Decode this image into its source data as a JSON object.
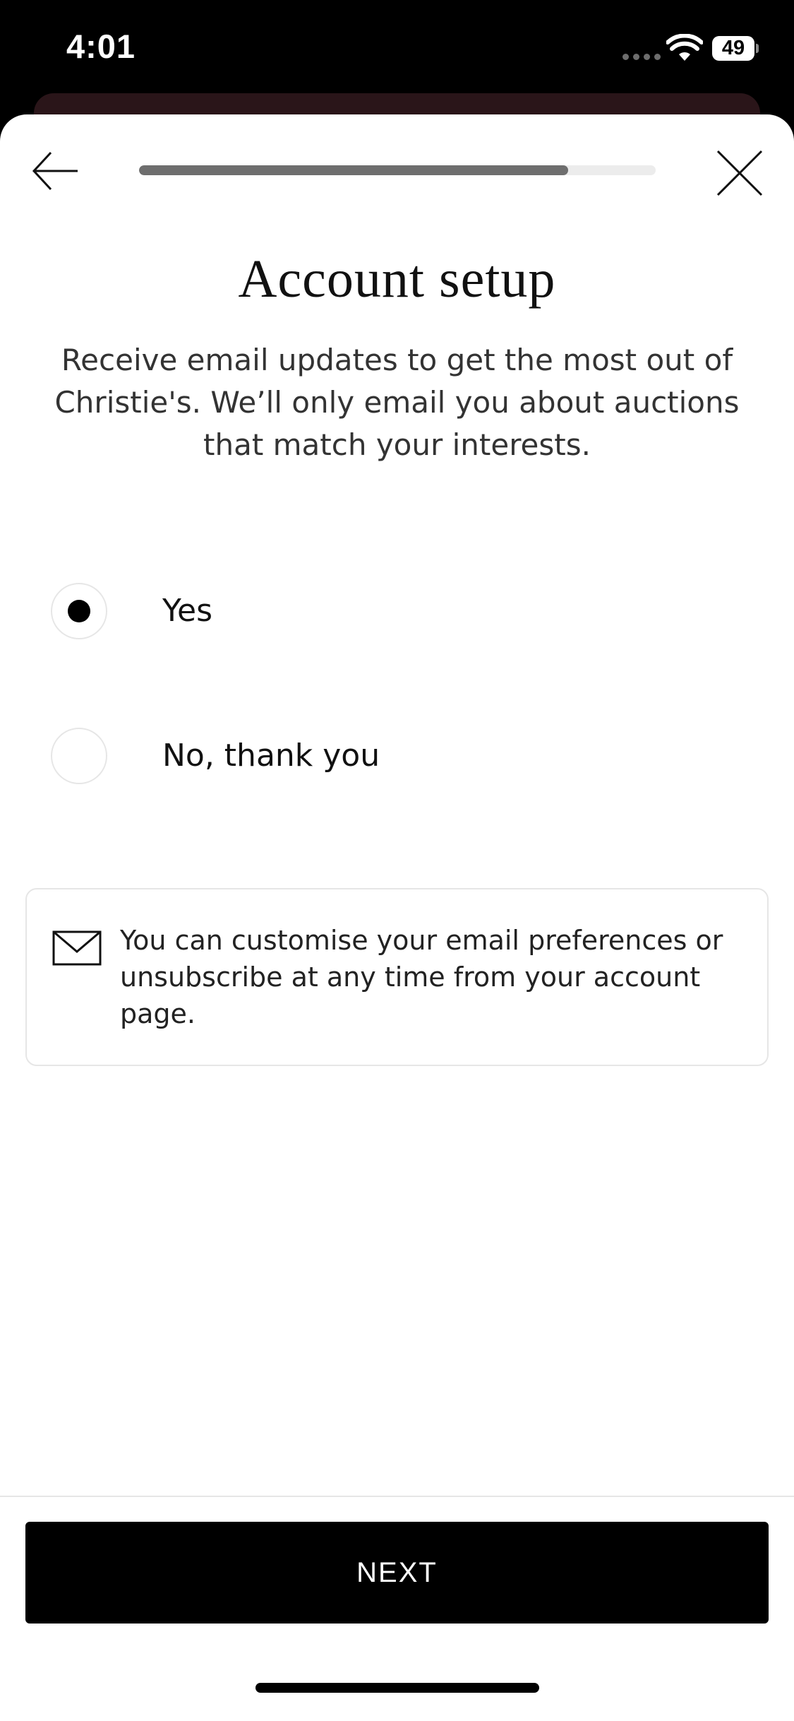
{
  "status_bar": {
    "time": "4:01",
    "battery_level": "49"
  },
  "header": {
    "progress_fraction": 0.83
  },
  "page": {
    "title": "Account setup",
    "description": "Receive email updates to get the most out of Christie's. We’ll only email you about auctions that match your interests."
  },
  "options": [
    {
      "label": "Yes",
      "selected": true
    },
    {
      "label": "No, thank you",
      "selected": false
    }
  ],
  "info": {
    "icon": "mail-icon",
    "text": "You can customise your email preferences or unsubscribe at any time from your account page."
  },
  "footer": {
    "next_label": "NEXT"
  },
  "colors": {
    "accent": "#000000",
    "progress_fill": "#6e6e6e",
    "progress_track": "#ececec"
  }
}
